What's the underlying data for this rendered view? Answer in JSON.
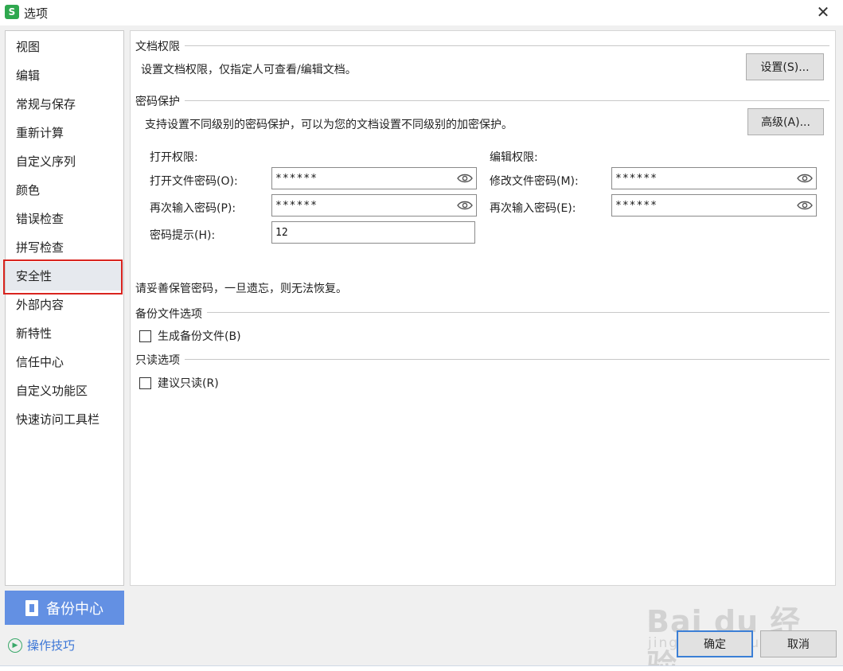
{
  "window": {
    "logo": "S",
    "title": "选项",
    "close": "✕"
  },
  "sidebar": {
    "items": [
      {
        "label": "视图"
      },
      {
        "label": "编辑"
      },
      {
        "label": "常规与保存"
      },
      {
        "label": "重新计算"
      },
      {
        "label": "自定义序列"
      },
      {
        "label": "颜色"
      },
      {
        "label": "错误检查"
      },
      {
        "label": "拼写检查"
      },
      {
        "label": "安全性"
      },
      {
        "label": "外部内容"
      },
      {
        "label": "新特性"
      },
      {
        "label": "信任中心"
      },
      {
        "label": "自定义功能区"
      },
      {
        "label": "快速访问工具栏"
      }
    ],
    "active_index": 8,
    "backup_center": "备份中心",
    "tips": "操作技巧"
  },
  "doc_permission": {
    "title": "文档权限",
    "desc": "设置文档权限，仅指定人可查看/编辑文档。",
    "button": "设置(S)..."
  },
  "password_protection": {
    "title": "密码保护",
    "desc": "支持设置不同级别的密码保护，可以为您的文档设置不同级别的加密保护。",
    "advanced_button": "高级(A)...",
    "open_permission_label": "打开权限:",
    "open_password_label": "打开文件密码(O):",
    "open_password_value": "******",
    "open_confirm_label": "再次输入密码(P):",
    "open_confirm_value": "******",
    "hint_label": "密码提示(H):",
    "hint_value": "12",
    "edit_permission_label": "编辑权限:",
    "modify_password_label": "修改文件密码(M):",
    "modify_password_value": "******",
    "modify_confirm_label": "再次输入密码(E):",
    "modify_confirm_value": "******",
    "warning": "请妥善保管密码，一旦遗忘，则无法恢复。"
  },
  "backup_options": {
    "title": "备份文件选项",
    "checkbox_label": "生成备份文件(B)",
    "checked": false
  },
  "readonly_options": {
    "title": "只读选项",
    "checkbox_label": "建议只读(R)",
    "checked": false
  },
  "footer": {
    "ok": "确定",
    "cancel": "取消"
  },
  "watermark": {
    "main": "Bai du 经验",
    "sub": "jingyan.baidu.com"
  },
  "colors": {
    "accent": "#6390e3",
    "highlight": "#d9241f",
    "focus": "#3b7fd6"
  },
  "icons": [
    "app-logo-icon",
    "close-icon",
    "backup-icon",
    "tips-icon",
    "eye-icon",
    "checkbox-icon"
  ]
}
